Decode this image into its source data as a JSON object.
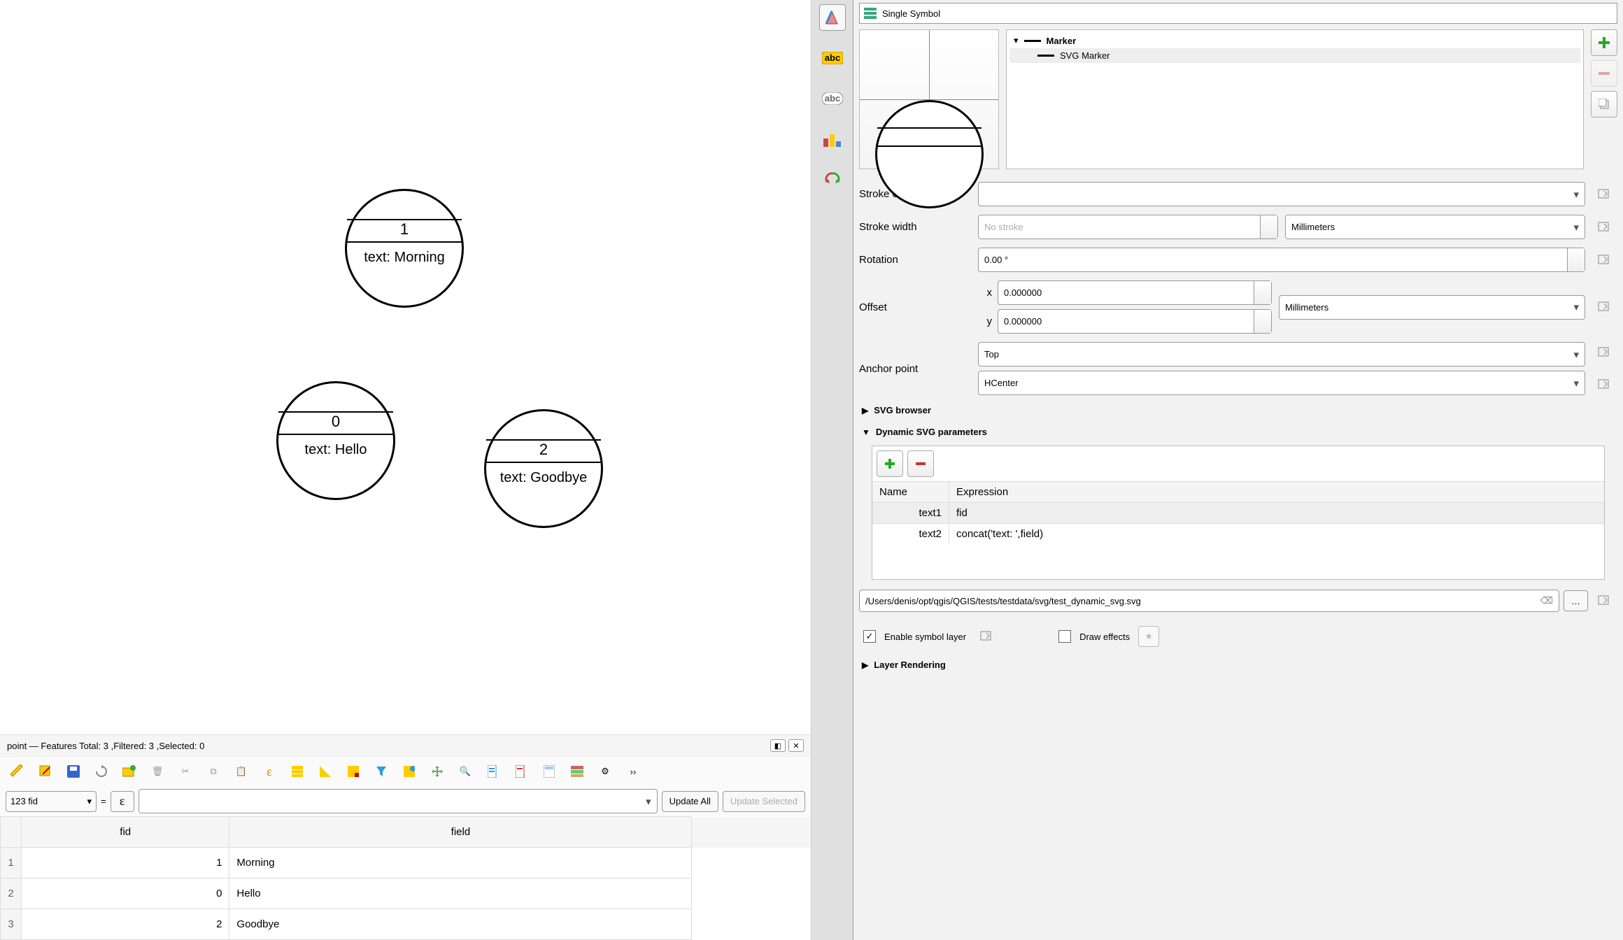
{
  "canvas": {
    "features": [
      {
        "id": "0",
        "text": "text: Hello"
      },
      {
        "id": "1",
        "text": "text: Morning"
      },
      {
        "id": "2",
        "text": "text: Goodbye"
      }
    ]
  },
  "attr": {
    "title": "point — Features Total: 3 ,Filtered: 3 ,Selected: 0",
    "field_selector": "123 fid",
    "eq": "=",
    "update_all": "Update All",
    "update_selected": "Update Selected",
    "columns": {
      "c1": "fid",
      "c2": "field"
    },
    "rows": [
      {
        "n": "1",
        "fid": "1",
        "field": "Morning"
      },
      {
        "n": "2",
        "fid": "0",
        "field": "Hello"
      },
      {
        "n": "3",
        "fid": "2",
        "field": "Goodbye"
      }
    ]
  },
  "symbol": {
    "type_label": "Single Symbol",
    "tree": {
      "root": "Marker",
      "child": "SVG Marker"
    },
    "stroke_color_label": "Stroke color",
    "stroke_width_label": "Stroke width",
    "stroke_width_value": "No stroke",
    "stroke_width_unit": "Millimeters",
    "rotation_label": "Rotation",
    "rotation_value": "0.00 °",
    "offset_label": "Offset",
    "offset_x_label": "x",
    "offset_x_value": "0.000000",
    "offset_y_label": "y",
    "offset_y_value": "0.000000",
    "offset_unit": "Millimeters",
    "anchor_label": "Anchor point",
    "anchor_v": "Top",
    "anchor_h": "HCenter",
    "svg_browser": "SVG browser",
    "dyn_params": "Dynamic SVG parameters",
    "params_head_name": "Name",
    "params_head_expr": "Expression",
    "params": [
      {
        "name": "text1",
        "expr": "fid"
      },
      {
        "name": "text2",
        "expr": "concat('text: ',field)"
      }
    ],
    "svg_path": "/Users/denis/opt/qgis/QGIS/tests/testdata/svg/test_dynamic_svg.svg",
    "browse": "…",
    "enable_layer": "Enable symbol layer",
    "draw_effects": "Draw effects",
    "layer_rendering": "Layer Rendering"
  }
}
